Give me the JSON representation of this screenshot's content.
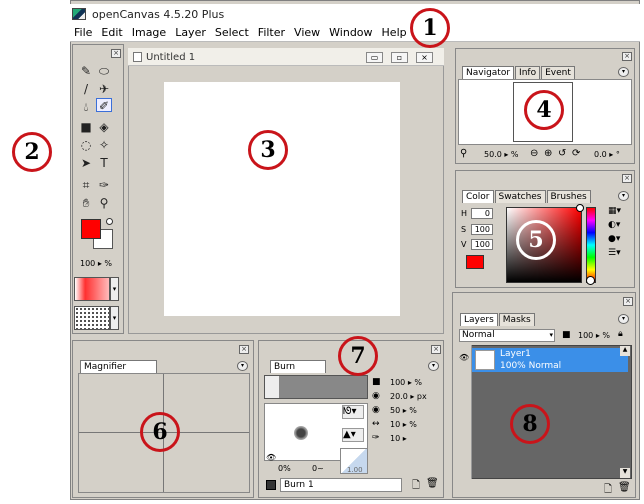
{
  "window": {
    "title": "openCanvas 4.5.20 Plus"
  },
  "menu": [
    "File",
    "Edit",
    "Image",
    "Layer",
    "Select",
    "Filter",
    "View",
    "Window",
    "Help"
  ],
  "document": {
    "title": "Untitled 1"
  },
  "toolbox": {
    "opacity": "100",
    "opacity_unit": "%",
    "fg_color": "#ff0000",
    "bg_color": "#ffffff"
  },
  "navigator": {
    "tabs": [
      "Navigator",
      "Info",
      "Event"
    ],
    "zoom": "50.0",
    "zoom_unit": "%",
    "rotation": "0.0",
    "rotation_unit": "°"
  },
  "color": {
    "tabs": [
      "Color",
      "Swatches",
      "Brushes"
    ],
    "h_label": "H",
    "h": "0",
    "s_label": "S",
    "s": "100",
    "v_label": "V",
    "v": "100",
    "current": "#ff0000"
  },
  "magnifier": {
    "tabs": [
      "Magnifier"
    ]
  },
  "brush": {
    "tabs": [
      "Burn"
    ],
    "size": "20.0",
    "size_unit": "px",
    "opacity": "100",
    "opacity_unit": "%",
    "density": "50",
    "density_unit": "%",
    "param4": "10",
    "param4_unit": "%",
    "param5": "10",
    "preset_name": "Burn 1",
    "min_a": "0%",
    "min_b": "0~",
    "pressure": "1.00"
  },
  "layers": {
    "tabs": [
      "Layers",
      "Masks"
    ],
    "blend_mode": "Normal",
    "opacity": "100",
    "opacity_unit": "%",
    "items": [
      {
        "name": "Layer1",
        "detail": "100% Normal"
      }
    ]
  },
  "callouts": [
    "1",
    "2",
    "3",
    "4",
    "5",
    "6",
    "7",
    "8"
  ],
  "colors": {
    "accent": "#c9141a",
    "selection": "#3b8fe8",
    "panel": "#d4d0c8"
  }
}
